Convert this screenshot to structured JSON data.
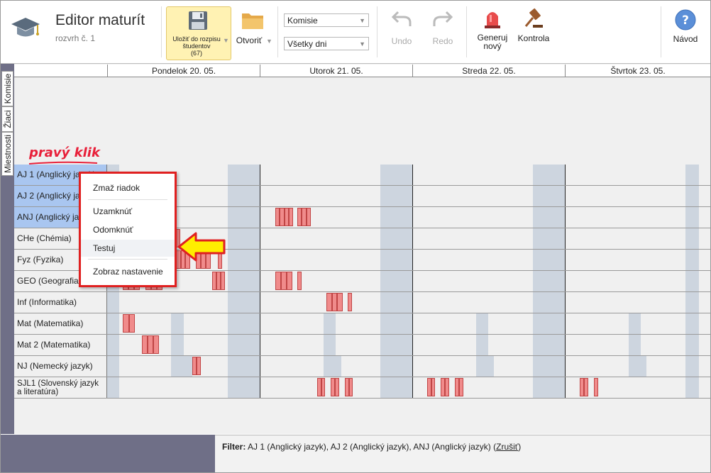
{
  "app": {
    "title": "Editor maturít",
    "subtitle": "rozvrh č. 1"
  },
  "toolbar": {
    "save_label": "Uložiť do rozpisu študentov",
    "save_count": "(67)",
    "open_label": "Otvoriť",
    "view_select": "Komisie",
    "day_select": "Všetky dni",
    "undo_label": "Undo",
    "redo_label": "Redo",
    "generate_label": "Generuj nový",
    "check_label": "Kontrola",
    "help_label": "Návod"
  },
  "vertical_tabs": [
    "Komisie",
    "Žiaci",
    "Miestnosti"
  ],
  "days": [
    "Pondelok 20. 05.",
    "Utorok 21. 05.",
    "Streda 22. 05.",
    "Štvrtok 23. 05."
  ],
  "rows": [
    {
      "label": "AJ 1 (Anglický jazyk)",
      "selected": true
    },
    {
      "label": "AJ 2 (Anglický jazyk)",
      "selected": true
    },
    {
      "label": "ANJ (Anglický jazyk)",
      "selected": true
    },
    {
      "label": "CHe (Chémia)",
      "selected": false
    },
    {
      "label": "Fyz (Fyzika)",
      "selected": false
    },
    {
      "label": "GEO (Geografia)",
      "selected": false
    },
    {
      "label": "Inf (Informatika)",
      "selected": false
    },
    {
      "label": "Mat (Matematika)",
      "selected": false
    },
    {
      "label": "Mat 2 (Matematika)",
      "selected": false
    },
    {
      "label": "NJ (Nemecký jazyk)",
      "selected": false
    },
    {
      "label": "SJL1 (Slovenský jazyk a literatúra)",
      "selected": false
    }
  ],
  "context_menu": {
    "items": [
      "Zmaž riadok",
      "Uzamknúť",
      "Odomknúť",
      "Testuj",
      "Zobraz nastavenie"
    ],
    "highlighted": "Testuj"
  },
  "annotation": "pravý klik",
  "filter": {
    "label": "Filter:",
    "value": "AJ 1 (Anglický jazyk), AJ 2 (Anglický jazyk), ANJ (Anglický jazyk)",
    "cancel_label": "Zrušiť"
  },
  "colors": {
    "accent_red": "#e02020",
    "arrow_yellow": "#ffee00",
    "selected_row": "#a9c6f0",
    "tab_bg": "#6f6f87"
  },
  "icons": [
    "mortarboard-icon",
    "floppy-disk-icon",
    "folder-icon",
    "undo-icon",
    "redo-icon",
    "siren-icon",
    "gavel-icon",
    "help-icon",
    "yellow-arrow-icon"
  ]
}
